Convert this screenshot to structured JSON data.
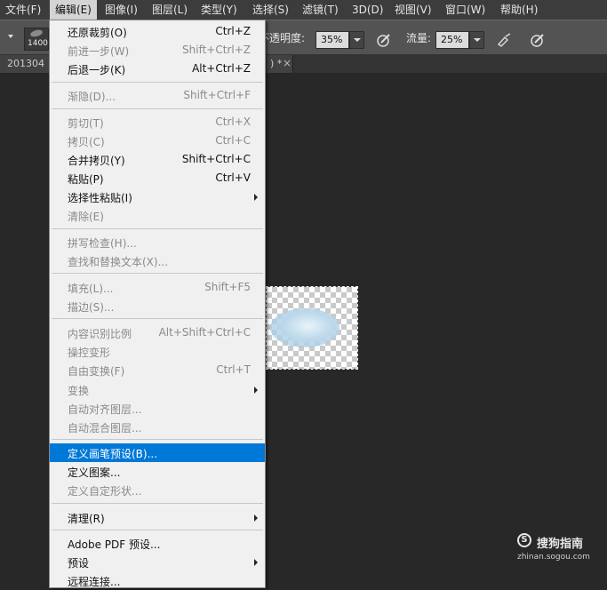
{
  "menubar": {
    "items": [
      {
        "label": "文件(F)"
      },
      {
        "label": "编辑(E)"
      },
      {
        "label": "图像(I)"
      },
      {
        "label": "图层(L)"
      },
      {
        "label": "类型(Y)"
      },
      {
        "label": "选择(S)"
      },
      {
        "label": "滤镜(T)"
      },
      {
        "label": "3D(D)"
      },
      {
        "label": "视图(V)"
      },
      {
        "label": "窗口(W)"
      },
      {
        "label": "帮助(H)"
      }
    ]
  },
  "options_bar": {
    "brush_size": "1400",
    "opacity_label": "不透明度:",
    "opacity_value": "35%",
    "flow_label": "流量:",
    "flow_value": "25%"
  },
  "document_tab": {
    "title_left": "201304",
    "title_right": ") *",
    "close_glyph": "×"
  },
  "edit_menu": {
    "items": [
      {
        "label": "还原裁剪(O)",
        "shortcut": "Ctrl+Z"
      },
      {
        "label": "前进一步(W)",
        "shortcut": "Shift+Ctrl+Z"
      },
      {
        "label": "后退一步(K)",
        "shortcut": "Alt+Ctrl+Z"
      },
      {
        "label": "渐隐(D)...",
        "shortcut": "Shift+Ctrl+F"
      },
      {
        "label": "剪切(T)",
        "shortcut": "Ctrl+X"
      },
      {
        "label": "拷贝(C)",
        "shortcut": "Ctrl+C"
      },
      {
        "label": "合并拷贝(Y)",
        "shortcut": "Shift+Ctrl+C"
      },
      {
        "label": "粘贴(P)",
        "shortcut": "Ctrl+V"
      },
      {
        "label": "选择性粘贴(I)",
        "shortcut": ""
      },
      {
        "label": "清除(E)",
        "shortcut": ""
      },
      {
        "label": "拼写检查(H)...",
        "shortcut": ""
      },
      {
        "label": "查找和替换文本(X)...",
        "shortcut": ""
      },
      {
        "label": "填充(L)...",
        "shortcut": "Shift+F5"
      },
      {
        "label": "描边(S)...",
        "shortcut": ""
      },
      {
        "label": "内容识别比例",
        "shortcut": "Alt+Shift+Ctrl+C"
      },
      {
        "label": "操控变形",
        "shortcut": ""
      },
      {
        "label": "自由变换(F)",
        "shortcut": "Ctrl+T"
      },
      {
        "label": "变换",
        "shortcut": ""
      },
      {
        "label": "自动对齐图层...",
        "shortcut": ""
      },
      {
        "label": "自动混合图层...",
        "shortcut": ""
      },
      {
        "label": "定义画笔预设(B)...",
        "shortcut": ""
      },
      {
        "label": "定义图案...",
        "shortcut": ""
      },
      {
        "label": "定义自定形状...",
        "shortcut": ""
      },
      {
        "label": "清理(R)",
        "shortcut": ""
      },
      {
        "label": "Adobe PDF 预设...",
        "shortcut": ""
      },
      {
        "label": "预设",
        "shortcut": ""
      },
      {
        "label": "远程连接...",
        "shortcut": ""
      }
    ]
  },
  "watermark": {
    "logo_glyph": "S",
    "name": "搜狗指南",
    "url": "zhinan.sogou.com"
  },
  "colors": {
    "highlight": "#0078d7",
    "workspace": "#282828",
    "menu_bg": "#f0f0f0"
  }
}
